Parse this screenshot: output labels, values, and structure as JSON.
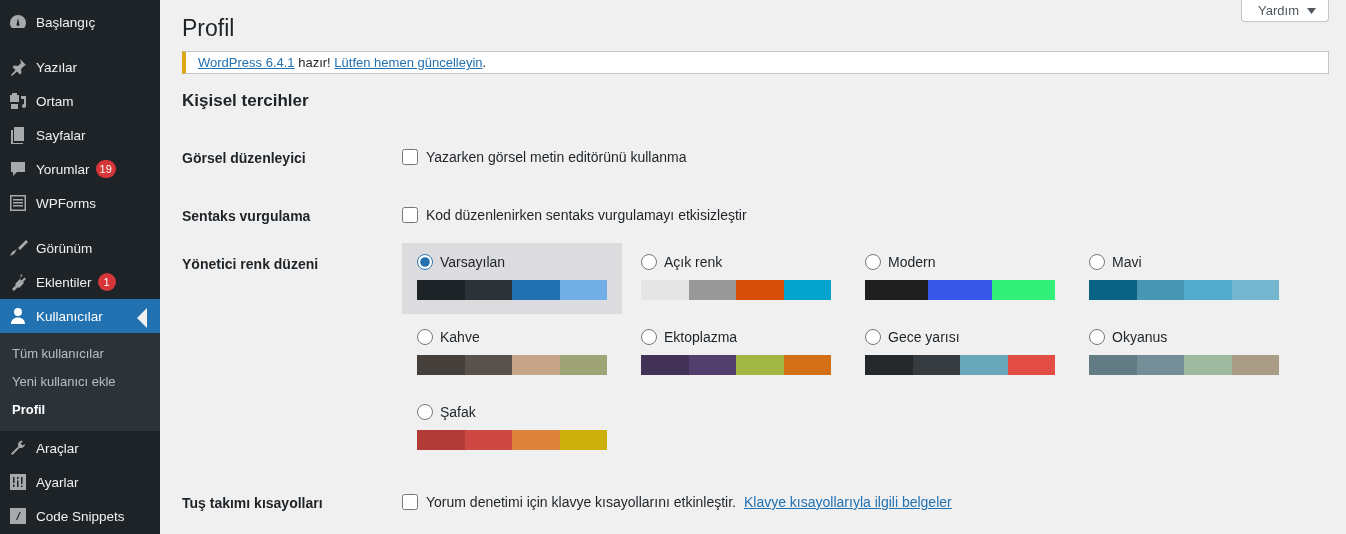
{
  "sidebar": {
    "groups": [
      {
        "items": [
          {
            "label": "Başlangıç",
            "selected": false
          }
        ]
      },
      {
        "items": [
          {
            "label": "Yazılar",
            "selected": false
          },
          {
            "label": "Ortam",
            "selected": false
          },
          {
            "label": "Sayfalar",
            "selected": false
          },
          {
            "label": "Yorumlar",
            "selected": false,
            "badge": "19"
          },
          {
            "label": "WPForms",
            "selected": false
          }
        ]
      },
      {
        "items": [
          {
            "label": "Görünüm",
            "selected": false
          },
          {
            "label": "Eklentiler",
            "selected": false,
            "badge": "1"
          },
          {
            "label": "Kullanıcılar",
            "selected": true,
            "children": [
              {
                "label": "Tüm kullanıcılar",
                "selected": false
              },
              {
                "label": "Yeni kullanıcı ekle",
                "selected": false
              },
              {
                "label": "Profil",
                "selected": true
              }
            ]
          },
          {
            "label": "Araçlar",
            "selected": false
          },
          {
            "label": "Ayarlar",
            "selected": false
          },
          {
            "label": "Code Snippets",
            "selected": false
          }
        ]
      }
    ]
  },
  "help_button": {
    "label": "Yardım"
  },
  "page_title": "Profil",
  "notice": {
    "version_link": "WordPress 6.4.1",
    "message": "hazır!",
    "update_link": "Lütfen hemen güncelleyin",
    "end": "."
  },
  "section_title": "Kişisel tercihler",
  "settings": [
    {
      "kind": "checkbox",
      "label": "Görsel düzenleyici",
      "checked": false,
      "text": "Yazarken görsel metin editörünü kullanma"
    },
    {
      "kind": "checkbox",
      "label": "Sentaks vurgulama",
      "checked": false,
      "text": "Kod düzenlenirken sentaks vurgulamayı etkisizleştir"
    },
    {
      "kind": "color_schemes",
      "label": "Yönetici renk düzeni",
      "schemes": [
        {
          "name": "Varsayılan",
          "selected": true,
          "swatches": [
            {
              "color": "#1d2327"
            },
            {
              "color": "#2c3338"
            },
            {
              "color": "#2271b1"
            },
            {
              "color": "#72aee6"
            }
          ]
        },
        {
          "name": "Açık renk",
          "selected": false,
          "swatches": [
            {
              "color": "#e5e5e5"
            },
            {
              "color": "#999999"
            },
            {
              "color": "#d64e07"
            },
            {
              "color": "#04a4cc"
            }
          ]
        },
        {
          "name": "Modern",
          "selected": false,
          "swatches": [
            {
              "color": "#1e1e1e"
            },
            {
              "color": "#3858e9"
            },
            {
              "color": "#33f078"
            }
          ]
        },
        {
          "name": "Mavi",
          "selected": false,
          "swatches": [
            {
              "color": "#096484"
            },
            {
              "color": "#4796b3"
            },
            {
              "color": "#52accc"
            },
            {
              "color": "#74b6ce"
            }
          ]
        },
        {
          "name": "Kahve",
          "selected": false,
          "swatches": [
            {
              "color": "#46403c"
            },
            {
              "color": "#59524c"
            },
            {
              "color": "#c7a589"
            },
            {
              "color": "#9ea476"
            }
          ]
        },
        {
          "name": "Ektoplazma",
          "selected": false,
          "swatches": [
            {
              "color": "#413256"
            },
            {
              "color": "#523f6d"
            },
            {
              "color": "#a3b745"
            },
            {
              "color": "#d46f15"
            }
          ]
        },
        {
          "name": "Gece yarısı",
          "selected": false,
          "swatches": [
            {
              "color": "#25282b"
            },
            {
              "color": "#363b3f"
            },
            {
              "color": "#69a8bb"
            },
            {
              "color": "#e14d43"
            }
          ]
        },
        {
          "name": "Okyanus",
          "selected": false,
          "swatches": [
            {
              "color": "#627c83"
            },
            {
              "color": "#738e96"
            },
            {
              "color": "#9ebaa0"
            },
            {
              "color": "#aa9d88"
            }
          ]
        },
        {
          "name": "Şafak",
          "selected": false,
          "swatches": [
            {
              "color": "#b43c38"
            },
            {
              "color": "#cf4944"
            },
            {
              "color": "#dd823b"
            },
            {
              "color": "#ccaf0b"
            }
          ]
        }
      ]
    },
    {
      "kind": "checkbox",
      "label": "Tuş takımı kısayolları",
      "checked": false,
      "text": "Yorum denetimi için klavye kısayollarını etkinleştir.",
      "link": "Klavye kısayollarıyla ilgili belgeler"
    }
  ]
}
